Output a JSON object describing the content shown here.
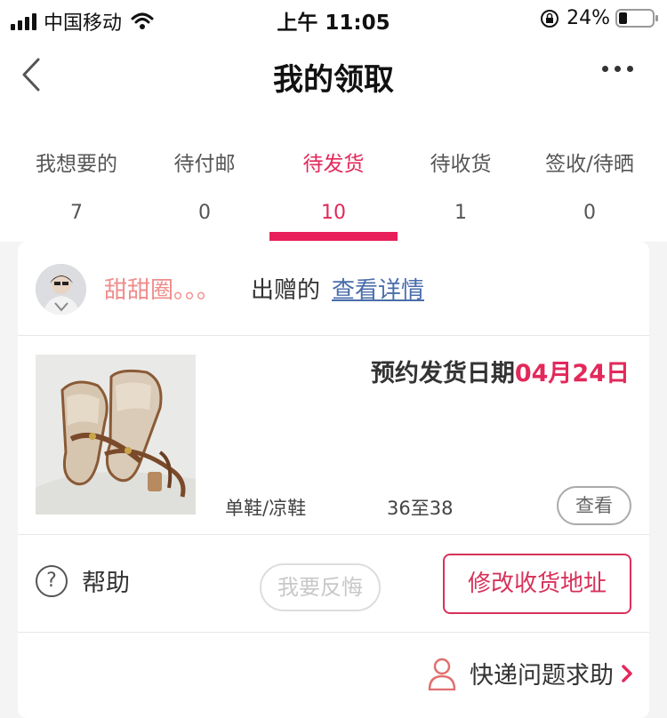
{
  "status_bar": {
    "carrier": "中国移动",
    "time": "上午 11:05",
    "battery": "24%",
    "battery_level": 0.24
  },
  "nav": {
    "title": "我的领取",
    "back_icon": "chevron-left-icon",
    "more_icon": "more-icon"
  },
  "tabs": [
    {
      "label": "我想要的",
      "count": "7"
    },
    {
      "label": "待付邮",
      "count": "0"
    },
    {
      "label": "待发货",
      "count": "10",
      "active": true
    },
    {
      "label": "待收货",
      "count": "1"
    },
    {
      "label": "签收/待晒",
      "count": "0"
    }
  ],
  "order": {
    "giver_name": "甜甜圈。。。",
    "giver_verb": "出赠的",
    "details_link": "查看详情",
    "ship_date_label": "预约发货日期",
    "ship_date": "04月24日",
    "category": "单鞋/凉鞋",
    "size": "36至38",
    "view_button": "查看",
    "help_label": "帮助",
    "regret_button": "我要反悔",
    "change_address_button": "修改收货地址"
  },
  "delivery_help": {
    "label": "快递问题求助",
    "icon": "person-icon"
  },
  "colors": {
    "accent": "#e3285a",
    "link": "#4a6dab",
    "giver_name": "#ef8c8c"
  }
}
